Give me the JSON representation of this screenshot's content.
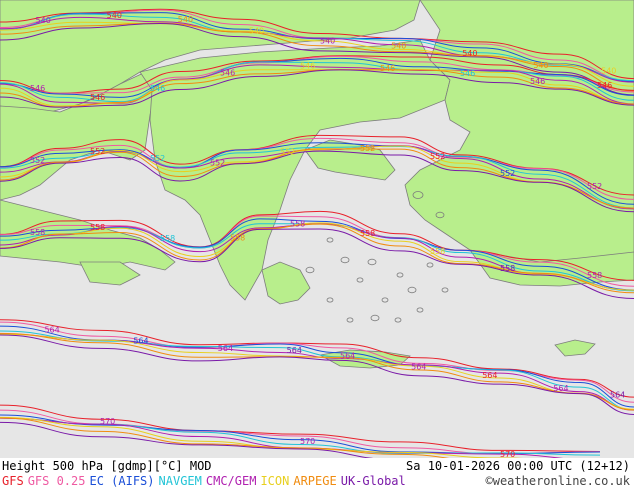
{
  "footer": {
    "title": "Height 500 hPa [gdmp][°C] MOD",
    "datetime": "Sa 10-01-2026 00:00 UTC (12+12)",
    "credit": "©weatheronline.co.uk",
    "models": [
      {
        "name": "GFS",
        "color": "#e8212b"
      },
      {
        "name": "GFS 0.25",
        "color": "#ef5aa2"
      },
      {
        "name": "EC (AIFS)",
        "color": "#1b4fd8"
      },
      {
        "name": "NAVGEM",
        "color": "#22c4d6"
      },
      {
        "name": "CMC/GEM",
        "color": "#b020b0"
      },
      {
        "name": "ICON",
        "color": "#e8d020"
      },
      {
        "name": "ARPEGE",
        "color": "#f08c10"
      },
      {
        "name": "UK-Global",
        "color": "#7a1aa8"
      }
    ]
  },
  "colors": {
    "land": "#b8ee8c",
    "sea": "#e6e6e6",
    "coast": "#7d7d7d"
  },
  "contours": [
    {
      "level": "540",
      "labels": [
        {
          "text": "540",
          "color": "#b020b0"
        },
        {
          "text": "540",
          "color": "#e8212b"
        },
        {
          "text": "540",
          "color": "#f08c10"
        },
        {
          "text": "540",
          "color": "#e8d020"
        },
        {
          "text": "540",
          "color": "#b020b0"
        },
        {
          "text": "540",
          "color": "#f08c10"
        },
        {
          "text": "540",
          "color": "#e8212b"
        },
        {
          "text": "540",
          "color": "#f08c10"
        },
        {
          "text": "540",
          "color": "#e8d020"
        }
      ]
    },
    {
      "level": "546",
      "labels": [
        {
          "text": "546",
          "color": "#b020b0"
        },
        {
          "text": "546",
          "color": "#e8212b"
        },
        {
          "text": "546",
          "color": "#22c4d6"
        },
        {
          "text": "546",
          "color": "#b020b0"
        },
        {
          "text": "546",
          "color": "#e8d020"
        },
        {
          "text": "546",
          "color": "#f08c10"
        },
        {
          "text": "546",
          "color": "#22c4d6"
        },
        {
          "text": "546",
          "color": "#b020b0"
        },
        {
          "text": "546",
          "color": "#e8212b"
        }
      ]
    },
    {
      "level": "552",
      "labels": [
        {
          "text": "552",
          "color": "#b020b0"
        },
        {
          "text": "552",
          "color": "#e8212b"
        },
        {
          "text": "552",
          "color": "#22c4d6"
        },
        {
          "text": "552",
          "color": "#b020b0"
        },
        {
          "text": "552",
          "color": "#e8d020"
        },
        {
          "text": "552",
          "color": "#f08c10"
        },
        {
          "text": "552",
          "color": "#e8212b"
        },
        {
          "text": "552",
          "color": "#1b4fd8"
        },
        {
          "text": "552",
          "color": "#b020b0"
        }
      ]
    },
    {
      "level": "558",
      "labels": [
        {
          "text": "558",
          "color": "#b020b0"
        },
        {
          "text": "558",
          "color": "#e8212b"
        },
        {
          "text": "558",
          "color": "#22c4d6"
        },
        {
          "text": "558",
          "color": "#f08c10"
        },
        {
          "text": "558",
          "color": "#b020b0"
        },
        {
          "text": "558",
          "color": "#e8212b"
        },
        {
          "text": "558",
          "color": "#e8d020"
        },
        {
          "text": "558",
          "color": "#7a1aa8"
        },
        {
          "text": "558",
          "color": "#b020b0"
        }
      ]
    },
    {
      "level": "564",
      "labels": [
        {
          "text": "564",
          "color": "#b020b0"
        },
        {
          "text": "564",
          "color": "#1b4fd8"
        },
        {
          "text": "564",
          "color": "#b020b0"
        },
        {
          "text": "564",
          "color": "#7a1aa8"
        },
        {
          "text": "564",
          "color": "#b020b0"
        },
        {
          "text": "564",
          "color": "#b020b0"
        },
        {
          "text": "564",
          "color": "#e8212b"
        },
        {
          "text": "564",
          "color": "#b020b0"
        },
        {
          "text": "564",
          "color": "#7a1aa8"
        }
      ]
    },
    {
      "level": "570",
      "labels": [
        {
          "text": "570",
          "color": "#b020b0"
        },
        {
          "text": "570",
          "color": "#b020b0"
        },
        {
          "text": "570",
          "color": "#e8212b"
        }
      ]
    }
  ]
}
